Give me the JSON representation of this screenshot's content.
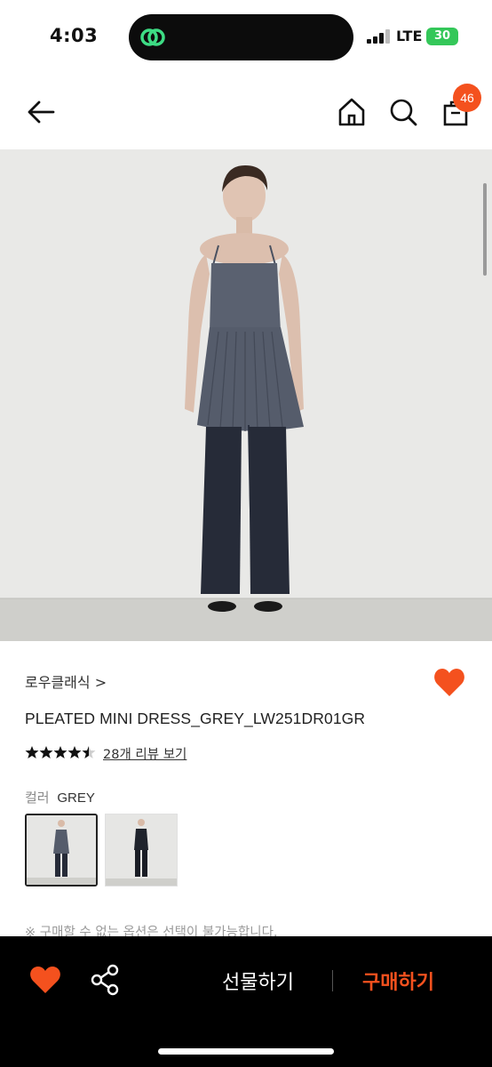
{
  "status_bar": {
    "time": "4:03",
    "network": "LTE",
    "battery": "30"
  },
  "nav": {
    "back_icon": "arrow-left-icon",
    "home_icon": "home-icon",
    "search_icon": "search-icon",
    "bag_icon": "shopping-bag-icon",
    "cart_count": "46"
  },
  "product": {
    "brand": "로우클래식",
    "brand_chevron": ">",
    "title": "PLEATED MINI DRESS_GREY_LW251DR01GR",
    "rating": 4.5,
    "review_link": "28개 리뷰 보기",
    "color_label": "컬러",
    "color_value": "GREY",
    "swatch_count": 2,
    "notice": "※ 구매할 수 없는 옵션은 선택이 불가능합니다."
  },
  "bottom_bar": {
    "wish_icon": "heart-icon",
    "share_icon": "share-icon",
    "gift_label": "선물하기",
    "buy_label": "구매하기"
  },
  "colors": {
    "accent": "#f4511e",
    "bottom_bar_bg": "#000000",
    "battery": "#34c759",
    "island_icon": "#3ddc84"
  }
}
